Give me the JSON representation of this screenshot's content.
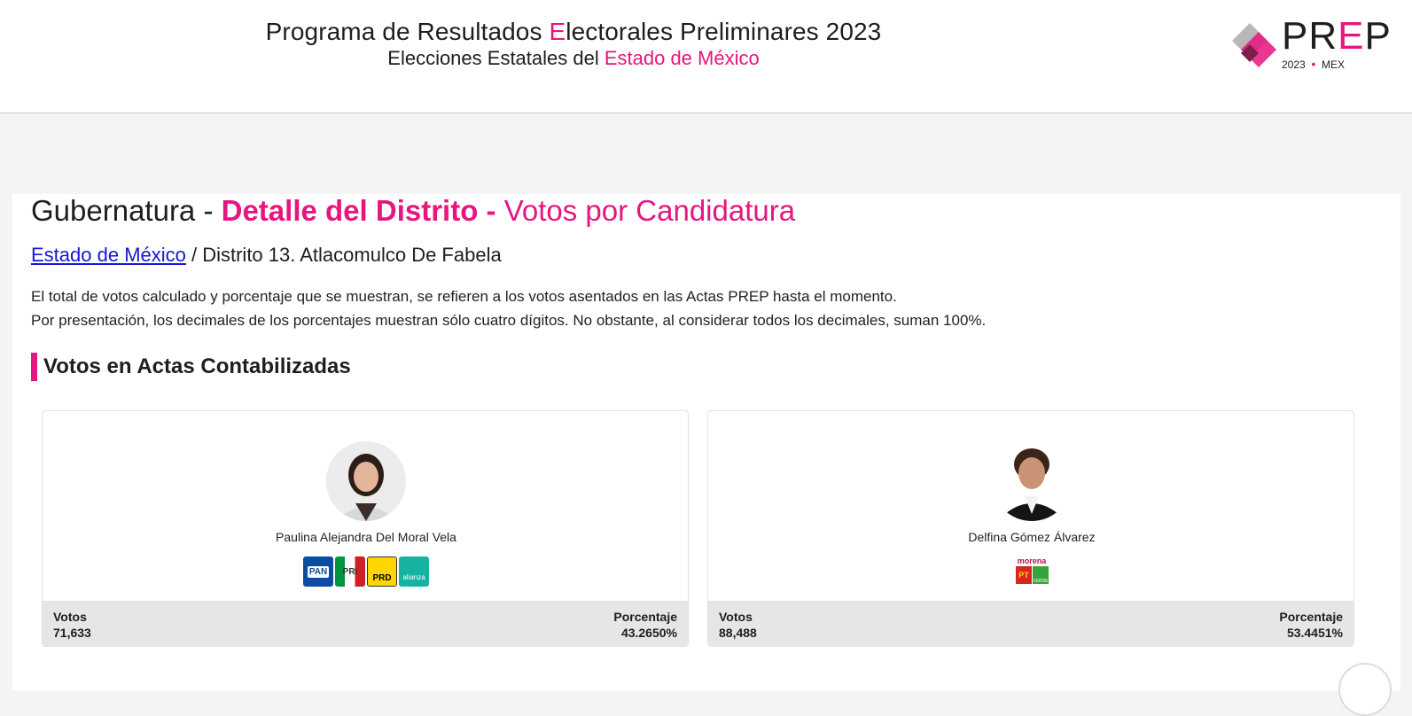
{
  "header": {
    "title_pre": "Programa de Resultados ",
    "title_hl": "E",
    "title_post": "lectorales Preliminares 2023",
    "subtitle_pre": "Elecciones Estatales del ",
    "subtitle_hl": "Estado de México",
    "logo_pre": "PR",
    "logo_e": "E",
    "logo_post": "P",
    "logo_year": "2023",
    "logo_dot": "•",
    "logo_region": "MEX"
  },
  "page": {
    "heading_a": "Gubernatura - ",
    "heading_b": "Detalle del Distrito - ",
    "heading_c": "Votos por Candidatura",
    "breadcrumb_link": "Estado de México",
    "breadcrumb_rest": " / Distrito 13. Atlacomulco De Fabela",
    "note_1": "El total de votos calculado y porcentaje que se muestran, se refieren a los votos asentados en las Actas PREP hasta el momento.",
    "note_2": "Por presentación, los decimales de los porcentajes muestran sólo cuatro dígitos. No obstante, al considerar todos los decimales, suman 100%.",
    "section_title": "Votos en Actas Contabilizadas"
  },
  "candidates": [
    {
      "name": "Paulina Alejandra Del Moral Vela",
      "parties": [
        "PAN",
        "PRI",
        "PRD",
        "alianza"
      ],
      "votes_label": "Votos",
      "votes": "71,633",
      "pct_label": "Porcentaje",
      "pct": "43.2650%"
    },
    {
      "name": "Delfina Gómez Álvarez",
      "parties": [
        "morena",
        "PT",
        "VERDE"
      ],
      "votes_label": "Votos",
      "votes": "88,488",
      "pct_label": "Porcentaje",
      "pct": "53.4451%"
    }
  ],
  "colors": {
    "accent": "#e6157f",
    "link": "#1515d6",
    "stats_bg": "#e6e6e6"
  }
}
